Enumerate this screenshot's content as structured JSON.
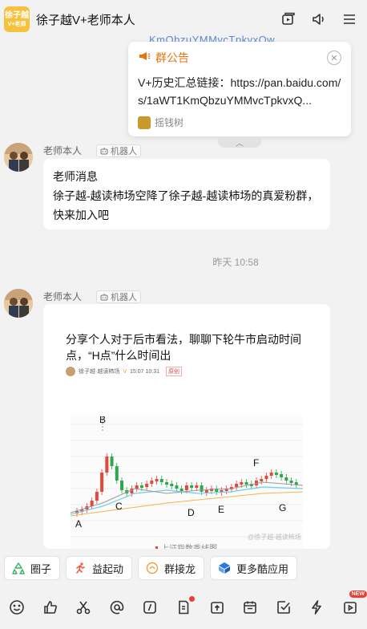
{
  "header": {
    "group_avatar_line1": "徐子越",
    "group_avatar_line2": "V+老师",
    "title": "徐子越V+老师本人"
  },
  "pinned_preview": "KmQbzuYMMvcTpkvxQw",
  "notice": {
    "title": "群公告",
    "body": "V+历史汇总链接：https://pan.baidu.com/s/1aWT1KmQbzuYMMvcTpkvxQ...",
    "footer": "摇钱树"
  },
  "messages": [
    {
      "sender": "老师本人",
      "badge": "机器人",
      "lines": [
        "老师消息",
        "徐子越-越读柿场空降了徐子越-越读柿场的真爱粉群，快来加入吧"
      ]
    },
    {
      "sender": "老师本人",
      "badge": "机器人",
      "article": {
        "title": "分享个人对于后市看法，聊聊下轮牛市启动时间点，“H点”什么时间出",
        "author": "徐子越·越读柿场",
        "date": "15:07 10:31",
        "tag": "原创",
        "watermark": "@徐子越-越读柿场",
        "caption": "上证指数季线图",
        "chart_labels": [
          "A",
          "B",
          "C",
          "D",
          "E",
          "F",
          "G"
        ]
      }
    }
  ],
  "timestamp": "昨天 10:58",
  "quick_actions": [
    {
      "label": "圈子",
      "icon": "recycle-icon",
      "color": "#3bb36a"
    },
    {
      "label": "益起动",
      "icon": "runner-icon",
      "color": "#f05a3a"
    },
    {
      "label": "群接龙",
      "icon": "dragon-icon",
      "color": "#f2a33a"
    },
    {
      "label": "更多酷应用",
      "icon": "cube-icon",
      "color": "#2a78e8"
    }
  ],
  "toolbar": {
    "new_badge": "NEW"
  }
}
